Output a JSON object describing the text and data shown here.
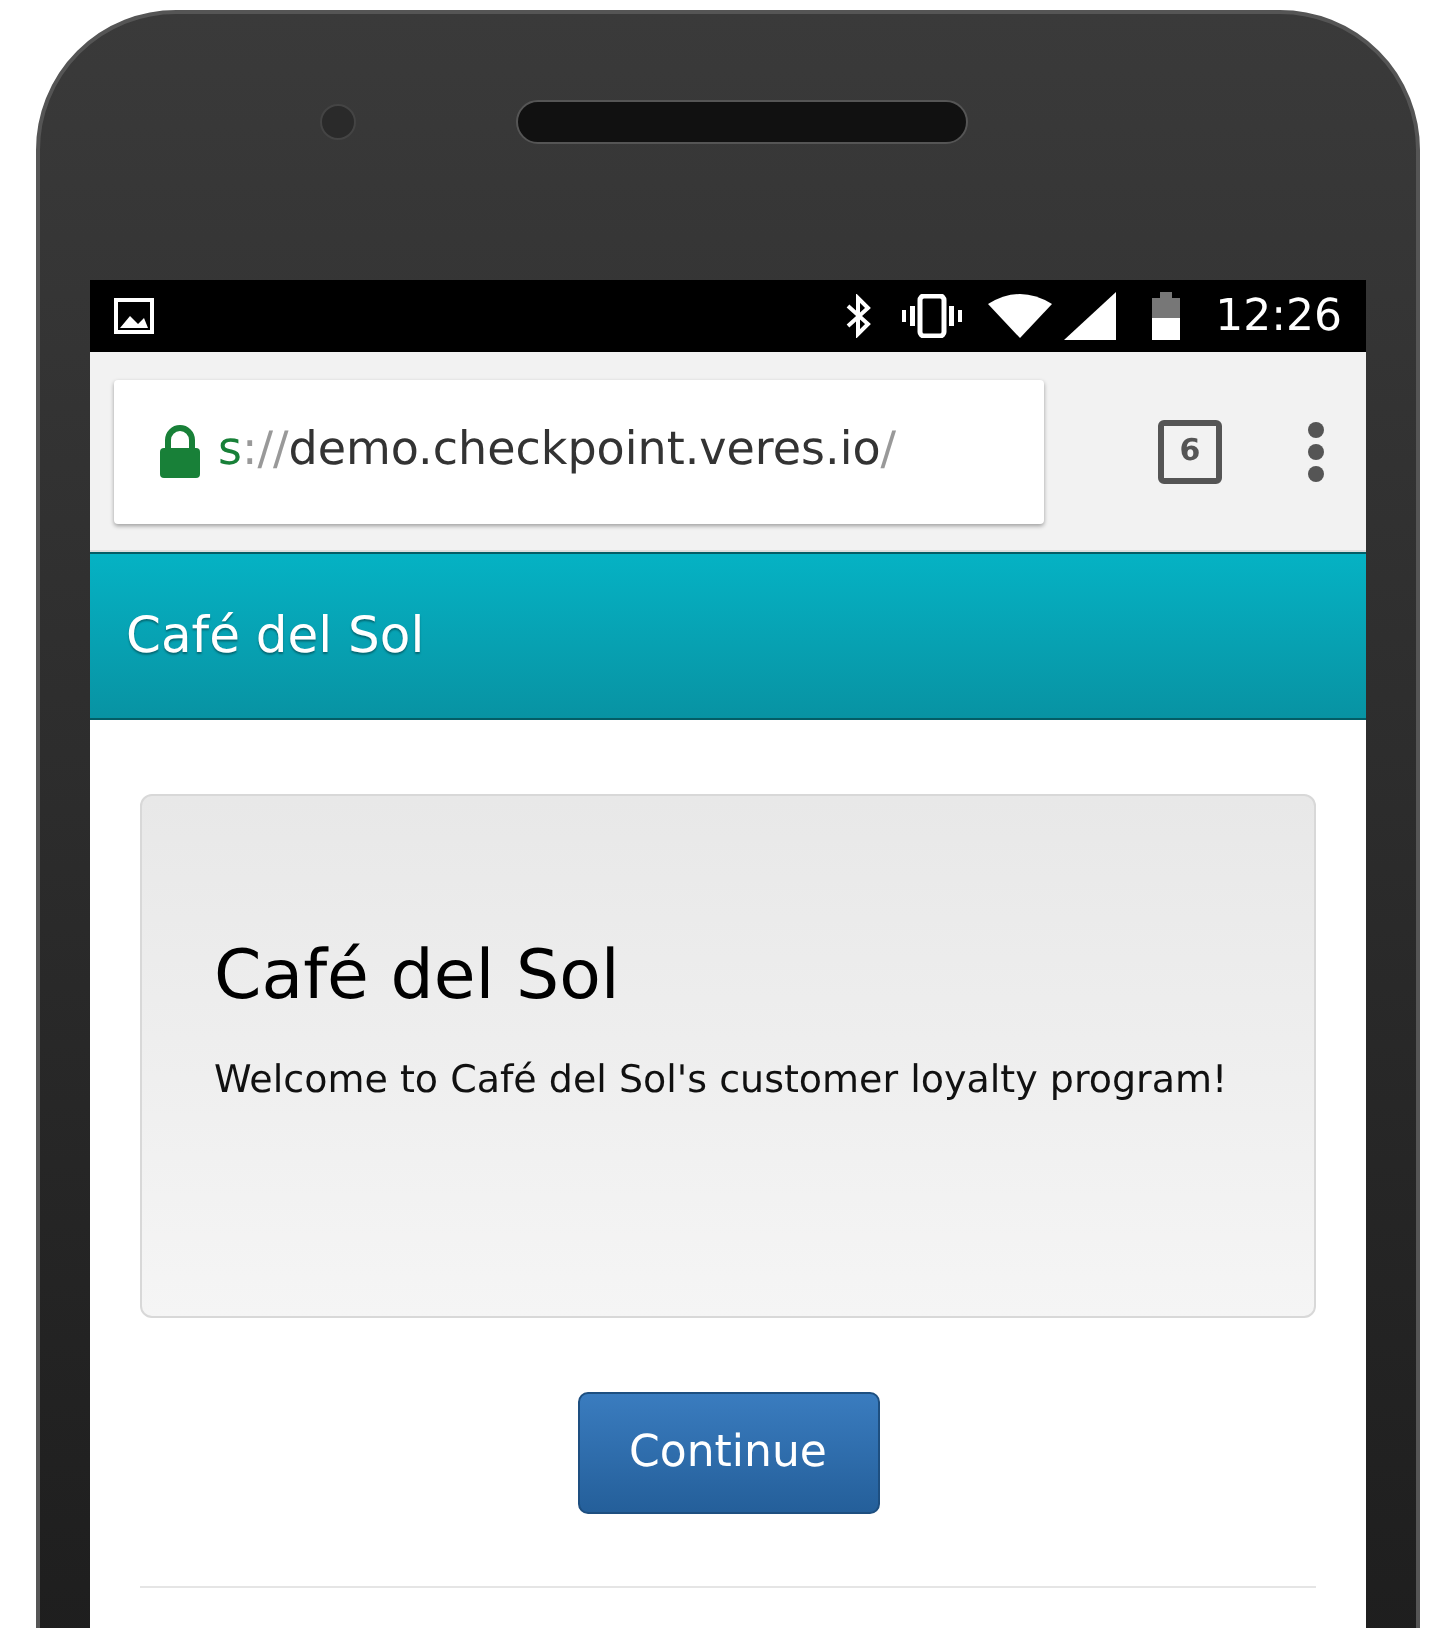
{
  "status_bar": {
    "time": "12:26"
  },
  "browser": {
    "url": {
      "scheme": "s",
      "separator": "://",
      "host": "demo.checkpoint.veres.io",
      "path": "/"
    },
    "tab_count": "6"
  },
  "app_bar": {
    "title": "Café del Sol"
  },
  "card": {
    "heading": "Café del Sol",
    "text": "Welcome to Café del Sol's customer loyalty program!"
  },
  "buttons": [
    "Continue"
  ]
}
